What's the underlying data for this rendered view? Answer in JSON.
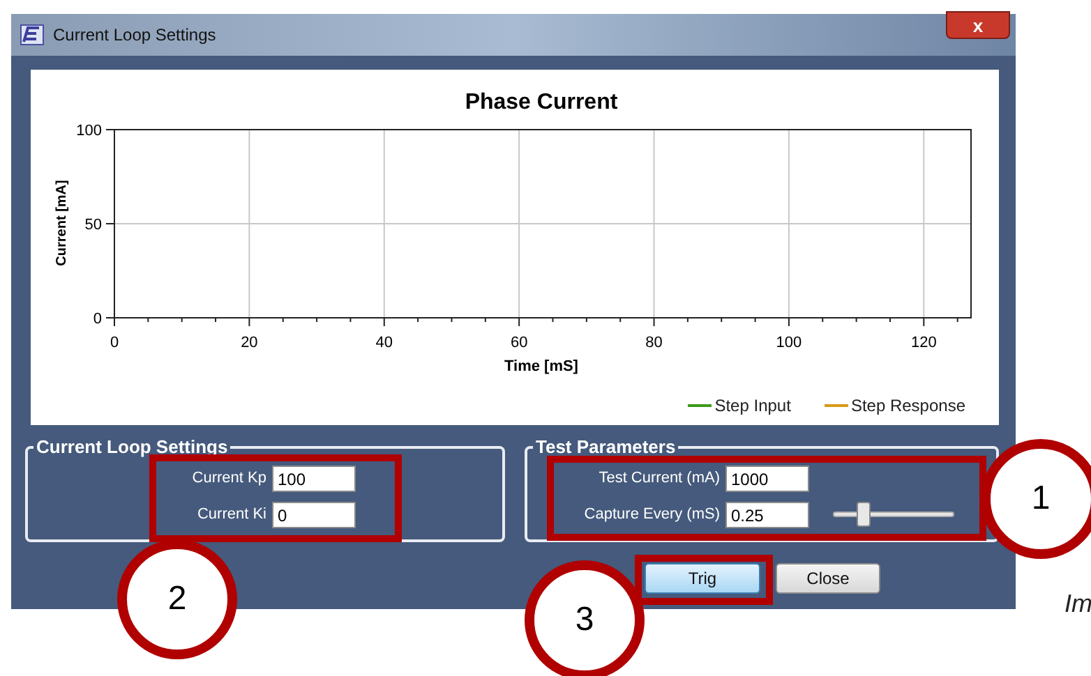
{
  "window": {
    "title": "Current Loop Settings",
    "close_label": "x"
  },
  "chart": {
    "chart_data": {
      "type": "line",
      "title": "Phase Current",
      "xlabel": "Time [mS]",
      "ylabel": "Current [mA]",
      "xlim": [
        0,
        127
      ],
      "ylim": [
        0,
        100
      ],
      "xticks": [
        0,
        20,
        40,
        60,
        80,
        100,
        120
      ],
      "yticks": [
        0,
        50,
        100
      ],
      "grid": true
    },
    "legend": [
      {
        "label": "Step Input",
        "color": "#3c9a1c"
      },
      {
        "label": "Step Response",
        "color": "#d89a18"
      }
    ]
  },
  "current_loop_settings": {
    "title": "Current Loop Settings",
    "fields": [
      {
        "label": "Current Kp",
        "value": "100"
      },
      {
        "label": "Current Ki",
        "value": "0"
      }
    ]
  },
  "test_parameters": {
    "title": "Test Parameters",
    "fields": [
      {
        "label": "Test Current (mA)",
        "value": "1000"
      },
      {
        "label": "Capture Every (mS)",
        "value": "0.25"
      }
    ],
    "slider": {
      "level": 0.25
    }
  },
  "buttons": [
    {
      "label": "Trig",
      "selected": true
    },
    {
      "label": "Close",
      "selected": false
    }
  ],
  "annotations": [
    {
      "number": "1"
    },
    {
      "number": "2"
    },
    {
      "number": "3"
    }
  ],
  "caption": "Im"
}
